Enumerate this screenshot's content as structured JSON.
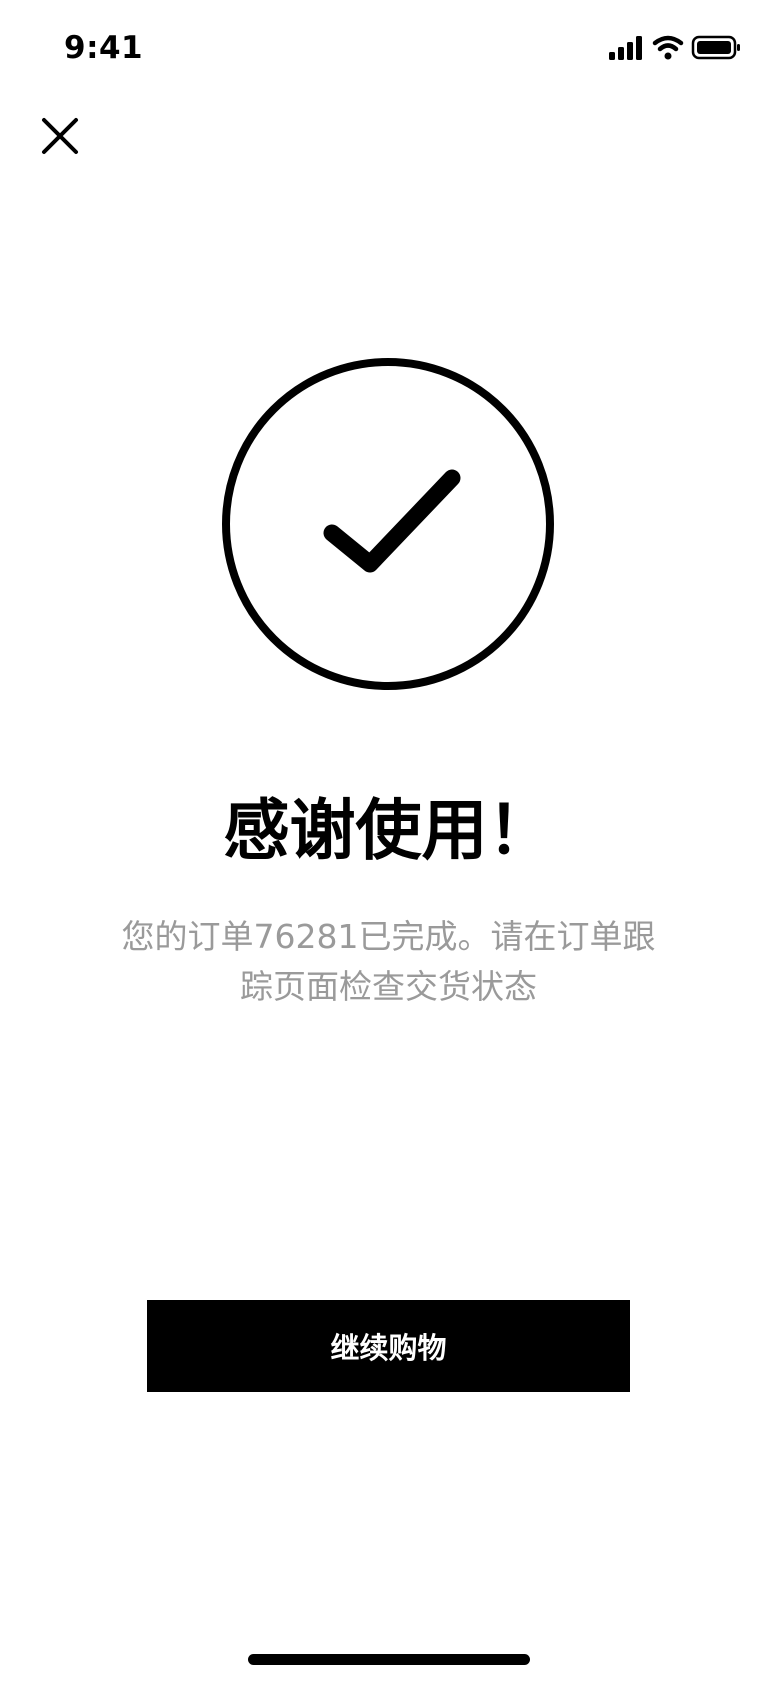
{
  "status_bar": {
    "time": "9:41",
    "icons": [
      "cellular-signal-icon",
      "wifi-icon",
      "battery-icon"
    ]
  },
  "header": {
    "close_icon": "close-icon"
  },
  "success": {
    "icon": "checkmark-circle-icon",
    "title": "感谢使用！",
    "message": "您的订单76281已完成。请在订单跟踪页面检查交货状态"
  },
  "actions": {
    "continue_label": "继续购物"
  },
  "colors": {
    "primary": "#000000",
    "background": "#ffffff",
    "secondary_text": "#9a9a9a",
    "button_text": "#ffffff"
  }
}
